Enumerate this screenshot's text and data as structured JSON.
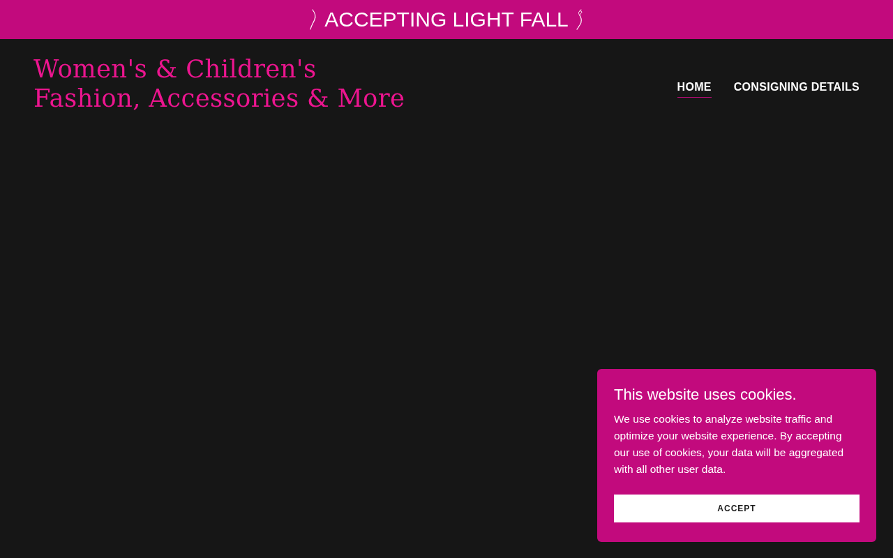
{
  "announcement_bar": {
    "text": "ACCEPTING LIGHT FALL"
  },
  "header": {
    "title_lines": [
      "Women's & Children's",
      "Fashion, Accessories & More"
    ],
    "nav": [
      {
        "label": "HOME",
        "selected": true
      },
      {
        "label": "CONSIGNING DETAILS",
        "selected": false
      }
    ]
  },
  "cookie_notice": {
    "heading": "This website uses cookies.",
    "body": "We use cookies to analyze website traffic and optimize your website experience. By accepting our use of cookies, your data will be aggregated with all other user data.",
    "button": "ACCEPT"
  }
}
